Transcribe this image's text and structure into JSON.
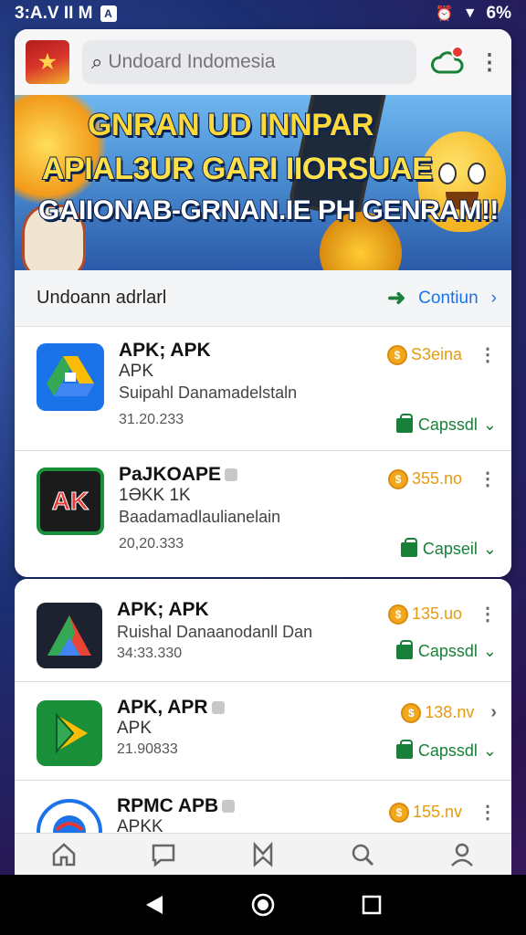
{
  "status_bar": {
    "time": "3:A.V II M",
    "notification_badge": "A",
    "battery": "6%"
  },
  "header": {
    "logo_icon": "emblem-logo",
    "search_placeholder": "Undoard Indomesia",
    "cloud_icon": "cloud-notification-icon"
  },
  "banner": {
    "line1": "GNRAN UD INNPAR",
    "line2": "APIAL3UR GARI IIORSUAE",
    "line3": "GAIIONAB-GRNAN.IE PH GENRAM!!"
  },
  "section": {
    "title": "Undoann adrlarl",
    "action_label": "Contiun"
  },
  "apps_card1": [
    {
      "name": "APK; APK",
      "sub": "APK",
      "desc": "Suipahl Danamadelstaln",
      "date": "31.20.233",
      "price": "S3eina",
      "status": "Capssdl",
      "icon_color": "#1a73e8",
      "verified": false
    },
    {
      "name": "PaJKOAPE",
      "sub": "1ƏKK 1K",
      "desc": "Baadamadlaulianelain",
      "date": "20,20.333",
      "price": "355.no",
      "status": "Capseil",
      "icon_color": "#111",
      "verified": true
    }
  ],
  "apps_card2": [
    {
      "name": "APK; APK",
      "sub": "",
      "desc": "Ruishal Danaanodanll Dan",
      "date": "34:33.330",
      "price": "135.uo",
      "status": "Capssdl",
      "verified": false
    },
    {
      "name": "APK, APR",
      "sub": "APK",
      "desc": "",
      "date": "21.90833",
      "price": "138.nv",
      "status": "Capssdl",
      "verified": true
    },
    {
      "name": "RPMC APB",
      "sub": "APKK",
      "desc": "",
      "date": "",
      "price": "155.nv",
      "status": "",
      "verified": true
    }
  ],
  "bottom_nav": [
    "home-icon",
    "chat-icon",
    "shield-icon",
    "search-icon",
    "profile-icon"
  ],
  "system_nav": [
    "back-icon",
    "home-circle-icon",
    "recents-icon"
  ],
  "colors": {
    "accent_green": "#188038",
    "accent_blue": "#1a73e8",
    "price_orange": "#e69a12"
  }
}
